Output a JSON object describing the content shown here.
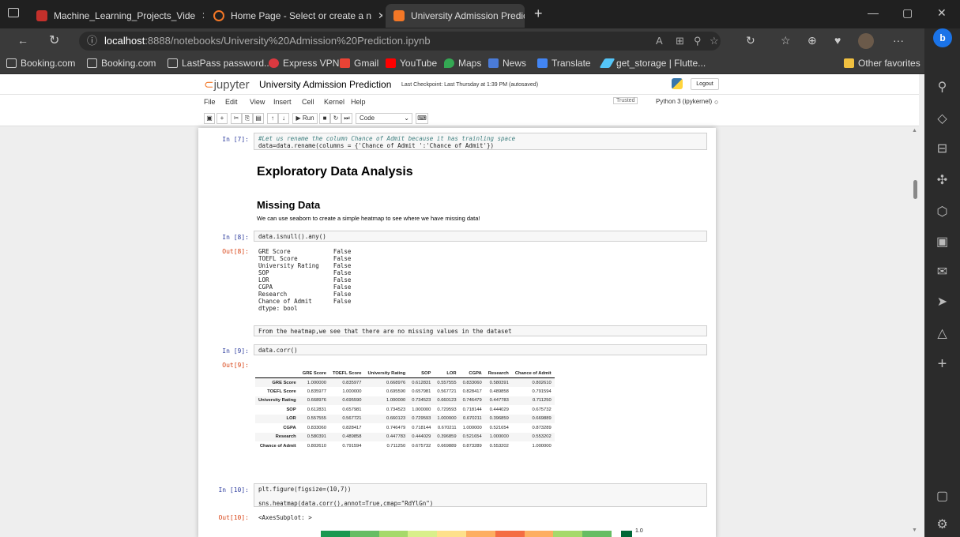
{
  "browser": {
    "tabs": [
      {
        "title": "Machine_Learning_Projects_Vide"
      },
      {
        "title": "Home Page - Select or create a n"
      },
      {
        "title": "University Admission Prediction"
      }
    ],
    "url_host": "localhost",
    "url_path": ":8888/notebooks/University%20Admission%20Prediction.ipynb",
    "favorites": [
      "Booking.com",
      "Booking.com",
      "LastPass password...",
      "Express VPN",
      "Gmail",
      "YouTube",
      "Maps",
      "News",
      "Translate",
      "get_storage | Flutte..."
    ],
    "other_favorites": "Other favorites"
  },
  "jupyter": {
    "logo": "jupyter",
    "notebook_title": "University Admission Prediction",
    "checkpoint": "Last Checkpoint: Last Thursday at 1:39 PM  (autosaved)",
    "logout": "Logout",
    "menu": [
      "File",
      "Edit",
      "View",
      "Insert",
      "Cell",
      "Kernel",
      "Help"
    ],
    "trusted": "Trusted",
    "kernel": "Python 3 (ipykernel)",
    "toolbar": {
      "run": "Run",
      "celltype": "Code"
    }
  },
  "cells": {
    "c7_prompt": "In [7]:",
    "c7_line1": "#Let us rename the column Chance of Admit because it has trainling space",
    "c7_line2": "data=data.rename(columns = {'Chance of Admit ':'Chance of Admit'})",
    "h_eda": "Exploratory Data Analysis",
    "h_missing": "Missing Data",
    "p_missing": "We can use seaborn to create a simple heatmap to see where we have missing data!",
    "c8_prompt": "In [8]:",
    "c8_code": "data.isnull().any()",
    "o8_prompt": "Out[8]:",
    "o8_text": "GRE Score            False\nTOEFL Score          False\nUniversity Rating    False\nSOP                  False\nLOR                  False\nCGPA                 False\nResearch             False\nChance of Admit      False\ndtype: bool",
    "raw_note": "From the heatmap,we see that there are no missing values in the dataset",
    "c9_prompt": "In [9]:",
    "c9_code": "data.corr()",
    "o9_prompt": "Out[9]:",
    "c10_prompt": "In [10]:",
    "c10_line1": "plt.figure(figsize=(10,7))",
    "c10_line2": "sns.heatmap(data.corr(),annot=True,cmap=\"RdYlGn\")",
    "o10_prompt": "Out[10]:",
    "o10_text": "<AxesSubplot: >",
    "colorbar_label": "1.0"
  },
  "corr_table": {
    "columns": [
      "GRE Score",
      "TOEFL Score",
      "University Rating",
      "SOP",
      "LOR",
      "CGPA",
      "Research",
      "Chance of Admit"
    ],
    "rows": [
      {
        "label": "GRE Score",
        "values": [
          "1.000000",
          "0.835977",
          "0.668976",
          "0.612831",
          "0.557555",
          "0.833060",
          "0.580391",
          "0.802610"
        ]
      },
      {
        "label": "TOEFL Score",
        "values": [
          "0.835977",
          "1.000000",
          "0.695590",
          "0.657981",
          "0.567721",
          "0.828417",
          "0.489858",
          "0.791594"
        ]
      },
      {
        "label": "University Rating",
        "values": [
          "0.668976",
          "0.695590",
          "1.000000",
          "0.734523",
          "0.660123",
          "0.746479",
          "0.447783",
          "0.711250"
        ]
      },
      {
        "label": "SOP",
        "values": [
          "0.612831",
          "0.657981",
          "0.734523",
          "1.000000",
          "0.729593",
          "0.718144",
          "0.444029",
          "0.675732"
        ]
      },
      {
        "label": "LOR",
        "values": [
          "0.557555",
          "0.567721",
          "0.660123",
          "0.729593",
          "1.000000",
          "0.670211",
          "0.396859",
          "0.669889"
        ]
      },
      {
        "label": "CGPA",
        "values": [
          "0.833060",
          "0.828417",
          "0.746479",
          "0.718144",
          "0.670211",
          "1.000000",
          "0.521654",
          "0.873289"
        ]
      },
      {
        "label": "Research",
        "values": [
          "0.580391",
          "0.489858",
          "0.447783",
          "0.444029",
          "0.396859",
          "0.521654",
          "1.000000",
          "0.553202"
        ]
      },
      {
        "label": "Chance of Admit",
        "values": [
          "0.802610",
          "0.791594",
          "0.711250",
          "0.675732",
          "0.669889",
          "0.873289",
          "0.553202",
          "1.000000"
        ]
      }
    ]
  },
  "heatmap_strip_colors": [
    "#1a9850",
    "#66bd63",
    "#a6d96a",
    "#d9ef8b",
    "#fee08b",
    "#fdae61",
    "#f46d43",
    "#fdae61",
    "#a6d96a",
    "#66bd63"
  ]
}
